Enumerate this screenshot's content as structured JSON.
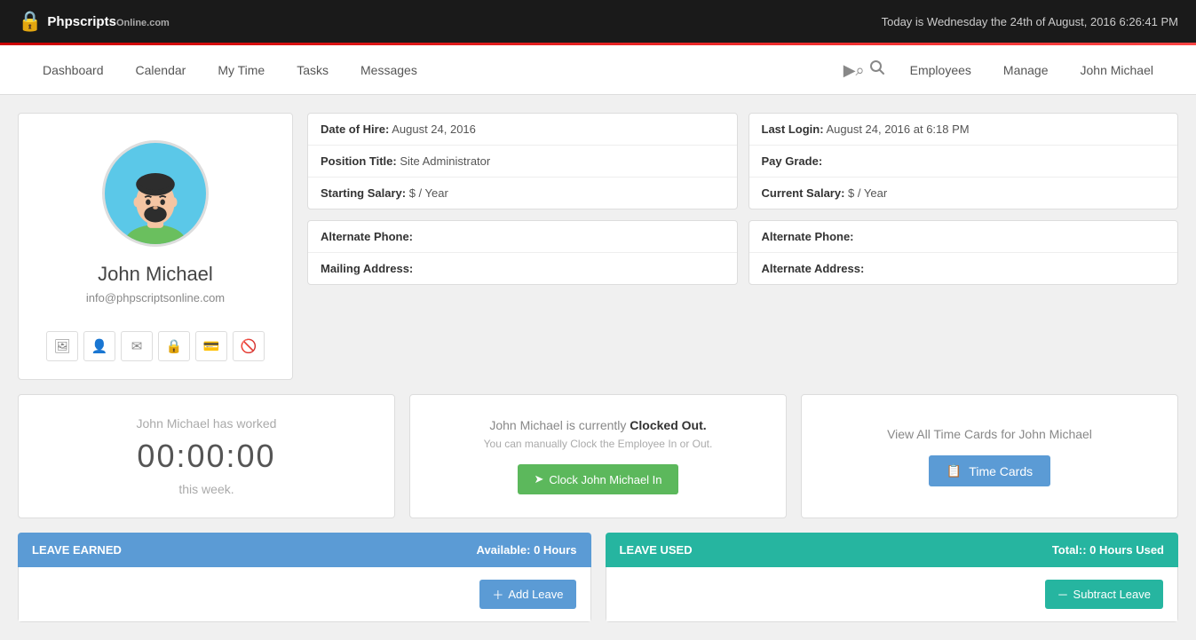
{
  "topbar": {
    "brand": "Phpscripts",
    "brand_sub": "Online.com",
    "datetime": "Today is Wednesday the 24th of August, 2016   6:26:41 PM"
  },
  "nav": {
    "items": [
      {
        "label": "Dashboard",
        "id": "dashboard"
      },
      {
        "label": "Calendar",
        "id": "calendar"
      },
      {
        "label": "My Time",
        "id": "my-time"
      },
      {
        "label": "Tasks",
        "id": "tasks"
      },
      {
        "label": "Messages",
        "id": "messages"
      }
    ],
    "right_items": [
      {
        "label": "Employees",
        "id": "employees"
      },
      {
        "label": "Manage",
        "id": "manage"
      },
      {
        "label": "John Michael",
        "id": "john-michael"
      }
    ]
  },
  "profile": {
    "name": "John Michael",
    "email": "info@phpscriptsonline.com"
  },
  "info_left": {
    "date_of_hire_label": "Date of Hire:",
    "date_of_hire_value": "August 24, 2016",
    "position_title_label": "Position Title:",
    "position_title_value": "Site Administrator",
    "starting_salary_label": "Starting Salary:",
    "starting_salary_value": "$ / Year",
    "alternate_phone_label": "Alternate Phone:",
    "mailing_address_label": "Mailing Address:"
  },
  "info_right": {
    "last_login_label": "Last Login:",
    "last_login_value": "August 24, 2016 at 6:18 PM",
    "pay_grade_label": "Pay Grade:",
    "current_salary_label": "Current Salary:",
    "current_salary_value": "$ / Year",
    "alternate_phone_label": "Alternate Phone:",
    "alternate_address_label": "Alternate Address:"
  },
  "worked": {
    "prefix": "John Michael has worked",
    "time": "00:00:00",
    "suffix": "this week."
  },
  "clock": {
    "status_text": "John Michael is currently ",
    "status_value": "Clocked Out.",
    "sub_text": "You can manually Clock the Employee In or Out.",
    "btn_label": "Clock John Michael In"
  },
  "timecards": {
    "title": "View All Time Cards for John Michael",
    "btn_label": "Time Cards"
  },
  "leave_earned": {
    "header": "LEAVE EARNED",
    "available": "Available: 0 Hours",
    "btn_label": "Add Leave"
  },
  "leave_used": {
    "header": "LEAVE USED",
    "total": "Total:: 0 Hours Used",
    "btn_label": "Subtract Leave"
  }
}
